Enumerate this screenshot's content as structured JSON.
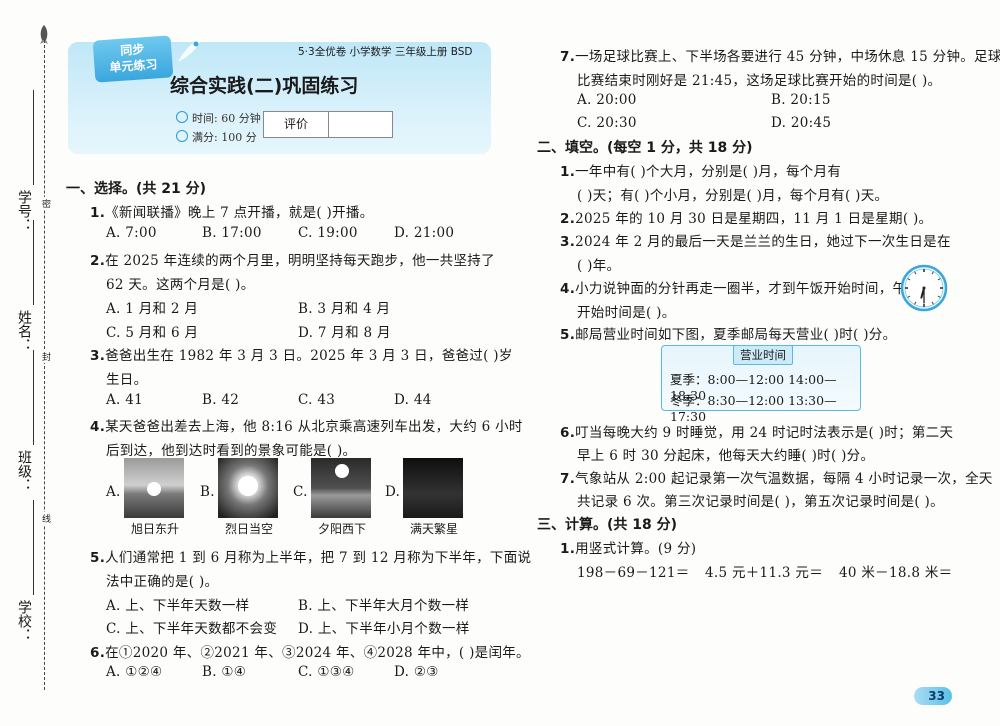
{
  "margin": {
    "student_id": "学号：",
    "name": "姓名：",
    "class": "班级：",
    "school": "学校：",
    "cut_marks": [
      "密",
      "封",
      "线"
    ]
  },
  "header": {
    "badge_line1": "同步",
    "badge_line2": "单元练习",
    "series": "5·3全优卷  小学数学  三年级上册  BSD",
    "title": "综合实践(二)巩固练习",
    "time": "时间: 60 分钟",
    "full_score": "满分: 100 分",
    "evaluation_label": "评价"
  },
  "section1": {
    "heading": "一、选择。(共 21 分)",
    "q1": {
      "num": "1.",
      "text": "《新闻联播》晚上 7 点开播，就是(      )开播。",
      "options": [
        "A. 7:00",
        "B. 17:00",
        "C. 19:00",
        "D. 21:00"
      ]
    },
    "q2": {
      "num": "2.",
      "line1": "在 2025 年连续的两个月里，明明坚持每天跑步，他一共坚持了",
      "line2": "62 天。这两个月是(      )。",
      "options": [
        "A. 1 月和 2 月",
        "B. 3 月和 4 月",
        "C. 5 月和 6 月",
        "D. 7 月和 8 月"
      ]
    },
    "q3": {
      "num": "3.",
      "line1": "爸爸出生在 1982 年 3 月 3 日。2025 年 3 月 3 日，爸爸过(        )岁",
      "line2": "生日。",
      "options": [
        "A. 41",
        "B. 42",
        "C. 43",
        "D. 44"
      ]
    },
    "q4": {
      "num": "4.",
      "line1": "某天爸爸出差去上海，他 8:16 从北京乘高速列车出发，大约 6 小时",
      "line2": "后到达，他到达时看到的景象可能是(      )。",
      "options": [
        "A.",
        "B.",
        "C.",
        "D."
      ],
      "captions": [
        "旭日东升",
        "烈日当空",
        "夕阳西下",
        "满天繁星"
      ]
    },
    "q5": {
      "num": "5.",
      "line1": "人们通常把 1 到 6 月称为上半年，把 7 到 12 月称为下半年，下面说",
      "line2": "法中正确的是(      )。",
      "options": [
        "A. 上、下半年天数一样",
        "B. 上、下半年大月个数一样",
        "C. 上、下半年天数都不会变",
        "D. 上、下半年小月个数一样"
      ]
    },
    "q6": {
      "num": "6.",
      "text": "在①2020 年、②2021 年、③2024 年、④2028 年中，(        )是闰年。",
      "options": [
        "A. ①②④",
        "B. ①④",
        "C. ①③④",
        "D. ②③"
      ]
    }
  },
  "right": {
    "q7": {
      "num": "7.",
      "line1": "一场足球比赛上、下半场各要进行 45 分钟，中场休息 15 分钟。足球",
      "line2": "比赛结束时刚好是 21:45，这场足球比赛开始的时间是(      )。",
      "options": [
        "A. 20:00",
        "B. 20:15",
        "C. 20:30",
        "D. 20:45"
      ]
    },
    "section2": {
      "heading": "二、填空。(每空 1 分，共 18 分)",
      "q1": {
        "num": "1.",
        "line1": "一年中有(      )个大月，分别是(                    )月，每个月有",
        "line2": "(      )天；有(      )个小月，分别是(                )月，每个月有(      )天。"
      },
      "q2": {
        "num": "2.",
        "text": "2025 年的 10 月 30 日是星期四，11 月 1 日是星期(      )。"
      },
      "q3": {
        "num": "3.",
        "line1": "2024 年 2 月的最后一天是兰兰的生日，她过下一次生日是在",
        "line2": "(        )年。"
      },
      "q4": {
        "num": "4.",
        "line1": "小力说钟面的分针再走一圈半，才到午饭开始时间，午饭",
        "line2": "开始时间是(      )。"
      },
      "q5": {
        "num": "5.",
        "text": "邮局营业时间如下图，夏季邮局每天营业(      )时(      )分。"
      },
      "schedule": {
        "title": "营业时间",
        "summer": "夏季：8:00—12:00     14:00—18:30",
        "winter": "冬季：8:30—12:00     13:30—17:30"
      },
      "q6": {
        "num": "6.",
        "line1": "叮当每晚大约 9 时睡觉，用 24 时记时法表示是(        )时；第二天",
        "line2": "早上 6 时 30 分起床，他每天大约睡(      )时(      )分。"
      },
      "q7": {
        "num": "7.",
        "line1": "气象站从 2:00 起记录第一次气温数据，每隔 4 小时记录一次，全天",
        "line2": "共记录 6 次。第三次记录时间是(        )，第五次记录时间是(        )。"
      }
    },
    "section3": {
      "heading": "三、计算。(共 18 分)",
      "q1": {
        "num": "1.",
        "text": "用竖式计算。(9 分)"
      },
      "exprs": [
        "198－69－121＝",
        "4.5 元＋11.3 元＝",
        "40 米－18.8 米＝"
      ]
    }
  },
  "clock": {
    "hour": 6,
    "minute": 30
  },
  "page_number": "33",
  "colors": {
    "accent": "#3aa6de",
    "header_bg": "#c9ecf9"
  }
}
